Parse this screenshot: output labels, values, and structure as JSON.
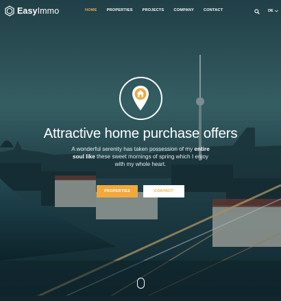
{
  "brand": {
    "name_bold": "Easy",
    "name_light": "Immo",
    "colors": {
      "accent": "#f2a93b",
      "text": "#ffffff"
    }
  },
  "nav": {
    "items": [
      {
        "label": "HOME",
        "active": true
      },
      {
        "label": "PROPERTIES",
        "active": false
      },
      {
        "label": "PROJECTS",
        "active": false
      },
      {
        "label": "COMPANY",
        "active": false
      },
      {
        "label": "CONTACT",
        "active": false
      }
    ],
    "search_icon": "search-icon",
    "language": "DE"
  },
  "hero": {
    "icon": "home-location-pin-icon",
    "title": "Attractive home purchase offers",
    "subtitle_before": "A wonderful serenity has taken possession of my ",
    "subtitle_bold": "entire soul like",
    "subtitle_after": " these sweet mornings of spring which I enjoy with my whole heart.",
    "buttons": {
      "primary": "PROPERTIES",
      "secondary": "CONTACT"
    },
    "scroll_icon": "mouse-scroll-icon"
  }
}
